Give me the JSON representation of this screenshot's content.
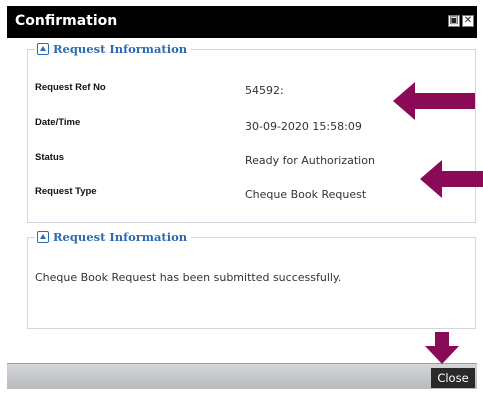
{
  "dialog": {
    "title": "Confirmation",
    "restore_icon": "restore-icon",
    "close_icon": "close-icon",
    "close_glyph": "✕",
    "restore_glyph": "▣"
  },
  "panels": [
    {
      "legend": "Request Information",
      "rows": [
        {
          "label": "Request Ref No",
          "value": "54592:"
        },
        {
          "label": "Date/Time",
          "value": "30-09-2020 15:58:09"
        },
        {
          "label": "Status",
          "value": "Ready for Authorization"
        },
        {
          "label": "Request Type",
          "value": "Cheque Book Request"
        }
      ]
    },
    {
      "legend": "Request Information",
      "message": "Cheque Book Request has been submitted successfully."
    }
  ],
  "footer": {
    "close_label": "Close"
  },
  "colors": {
    "accent": "#2b6cb0",
    "arrow": "#8b0a57",
    "titlebar": "#000000"
  }
}
